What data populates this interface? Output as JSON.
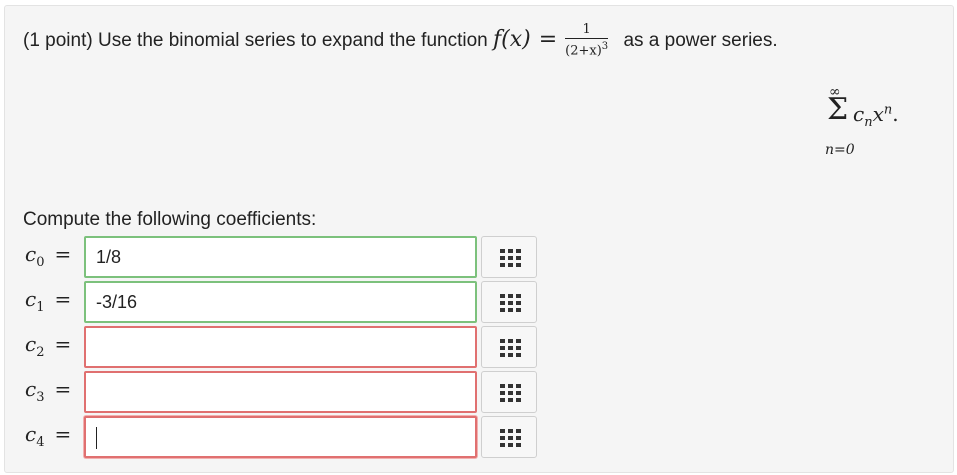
{
  "problem": {
    "points": "(1 point)",
    "text_before": "Use the binomial series to expand the function",
    "function_name": "f(x)",
    "equals": "=",
    "fraction": {
      "numerator": "1",
      "denominator": "(2+x)",
      "exponent": "3"
    },
    "text_after": "as a power series.",
    "series": {
      "upper": "∞",
      "lower": "n=0",
      "term_c": "c",
      "term_sub": "n",
      "term_x": "x",
      "term_sup": "n",
      "end": "."
    }
  },
  "prompt": "Compute the following coefficients:",
  "rows": [
    {
      "label": "c",
      "sub": "0",
      "equals": "=",
      "value": "1/8",
      "status": "correct"
    },
    {
      "label": "c",
      "sub": "1",
      "equals": "=",
      "value": "-3/16",
      "status": "correct"
    },
    {
      "label": "c",
      "sub": "2",
      "equals": "=",
      "value": "",
      "status": "incorrect"
    },
    {
      "label": "c",
      "sub": "3",
      "equals": "=",
      "value": "",
      "status": "incorrect"
    },
    {
      "label": "c",
      "sub": "4",
      "equals": "=",
      "value": "",
      "status": "focused"
    }
  ],
  "icons": {
    "palette": "equation-palette-icon"
  }
}
